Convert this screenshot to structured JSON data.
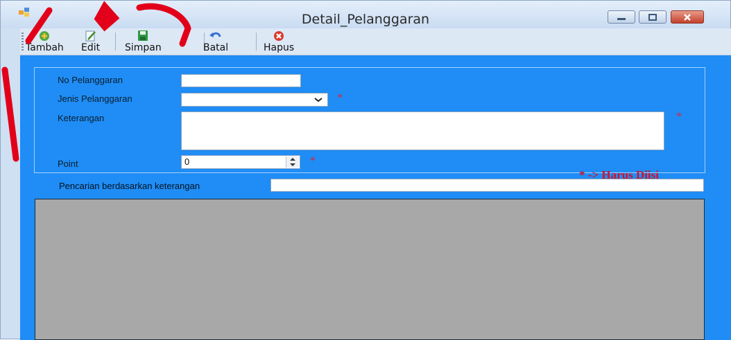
{
  "window": {
    "title": "Detail_Pelanggaran"
  },
  "toolbar": {
    "buttons": [
      {
        "label": "Tambah",
        "icon": "add-icon"
      },
      {
        "label": "Edit",
        "icon": "edit-icon"
      },
      {
        "label": "Simpan",
        "icon": "save-icon"
      },
      {
        "label": "Batal",
        "icon": "undo-icon"
      },
      {
        "label": "Hapus",
        "icon": "delete-icon"
      }
    ]
  },
  "form": {
    "no_pelanggaran_label": "No Pelanggaran",
    "no_pelanggaran_value": "",
    "jenis_pelanggaran_label": "Jenis Pelanggaran",
    "jenis_pelanggaran_value": "",
    "keterangan_label": "Keterangan",
    "keterangan_value": "",
    "point_label": "Point",
    "point_value": "0",
    "required_mark": "*",
    "required_legend": "* -> Harus Diisi"
  },
  "search": {
    "label": "Pencarian berdasarkan keterangan",
    "value": ""
  },
  "colors": {
    "client_bg": "#1f8df5",
    "required": "#d3102a",
    "grid_bg": "#a8a8a8"
  }
}
